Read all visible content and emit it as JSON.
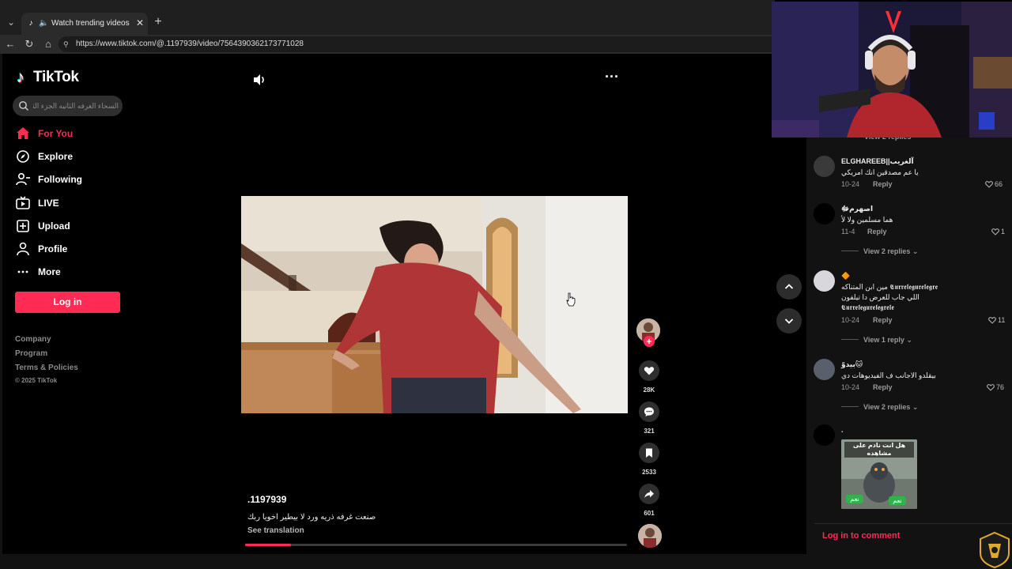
{
  "browser": {
    "tab_title": "Watch trending videos for yo",
    "url": "https://www.tiktok.com/@.1197939/video/7564390362173771028"
  },
  "sidebar": {
    "brand": "TikTok",
    "search_placeholder": "السحاء الغرفه الثانيه الجزء الثاني...",
    "items": [
      {
        "label": "For You",
        "icon": "home-icon",
        "active": true
      },
      {
        "label": "Explore",
        "icon": "compass-icon"
      },
      {
        "label": "Following",
        "icon": "following-icon"
      },
      {
        "label": "LIVE",
        "icon": "live-icon"
      },
      {
        "label": "Upload",
        "icon": "upload-icon"
      },
      {
        "label": "Profile",
        "icon": "profile-icon"
      },
      {
        "label": "More",
        "icon": "more-icon"
      }
    ],
    "login_label": "Log in",
    "footer": [
      "Company",
      "Program",
      "Terms & Policies"
    ],
    "copyright": "© 2025 TikTok"
  },
  "video": {
    "author": ".1197939",
    "caption": "صنعت غرفه ذريه ورد لا بيطير اخويا ربك",
    "see_translation": "See translation",
    "progress": 0.12
  },
  "actions": {
    "likes": "28K",
    "comments": "321",
    "saves": "2533",
    "shares": "601"
  },
  "comments_panel": {
    "view_top": "View 2 replies",
    "items": [
      {
        "name": "ELGHAREEB||آلغريب",
        "text": "يا عم مصدقين انك امريكي",
        "date": "10-24",
        "reply": "Reply",
        "likes": "66"
      },
      {
        "name": "اصهرمﷻ",
        "text": "هما مسلمين ولا لأ",
        "date": "11-4",
        "reply": "Reply",
        "likes": "1",
        "view": "View 2 replies"
      },
      {
        "name": "🔶",
        "text": "مين ابن المتناكه 𝕮𝖚𝖗𝖗𝖊𝖑𝖊𝖌𝖚𝖗𝖊𝖑𝖊𝖌𝖗𝖊",
        "text2": "اللي جاب للعرض دا تيلفون",
        "text3": "𝕮𝖚𝖗𝖗𝖊𝖑𝖊𝖌𝖚𝖗𝖊𝖑𝖊𝖌𝖗𝖊𝖑𝖊",
        "date": "10-24",
        "reply": "Reply",
        "likes": "11",
        "view": "View 1 reply"
      },
      {
        "name": "بيدوّ🐱",
        "text": "بيقلدو الاجانب ف الفيديوهات دي",
        "date": "10-24",
        "reply": "Reply",
        "likes": "76",
        "view": "View 2 replies"
      },
      {
        "name": ".",
        "sticker_top": "هل انت نادم على مشاهده",
        "sticker_yes": "نعم",
        "sticker_yes2": "نعم"
      }
    ],
    "login_prompt": "Log in to comment"
  },
  "colors": {
    "accent": "#fe2c55",
    "background": "#000000",
    "panel": "#121212"
  }
}
